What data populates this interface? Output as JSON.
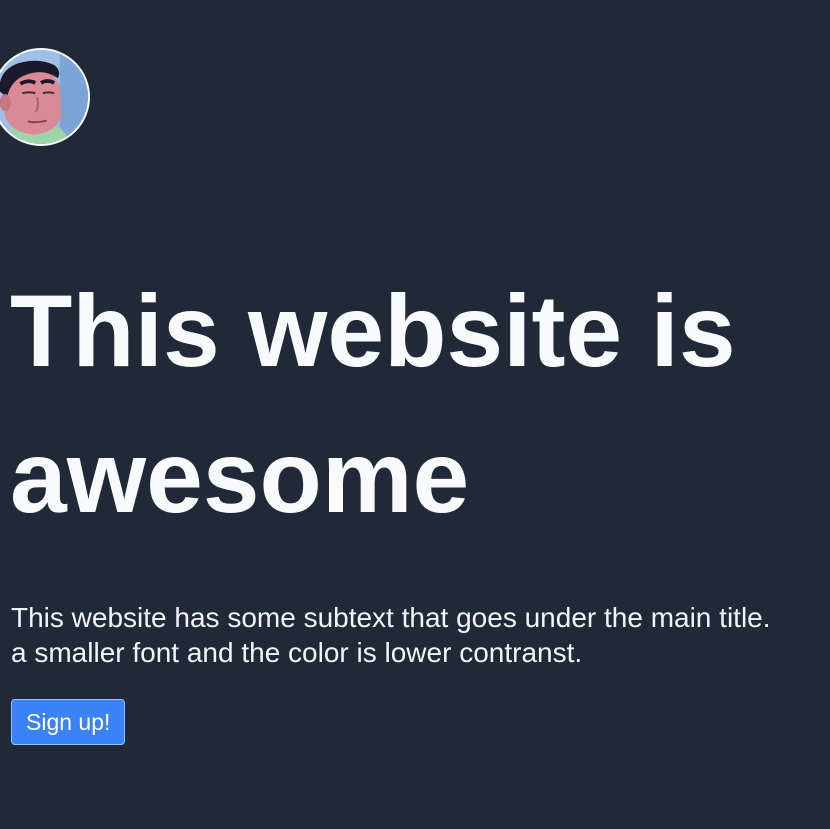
{
  "avatar": {
    "icon": "cartoon-man-avatar",
    "alt": "avatar"
  },
  "hero": {
    "title_line_1": "This website is",
    "title_line_2": "awesome",
    "subtext_line_1": "This website has some subtext that goes under the main title.",
    "subtext_line_2": "a smaller font and the color is lower contranst."
  },
  "cta": {
    "signup_label": "Sign up!"
  },
  "colors": {
    "background": "#1f2937",
    "title": "#f9fafb",
    "subtext": "#f3f4f6",
    "button": "#3b82f6"
  }
}
